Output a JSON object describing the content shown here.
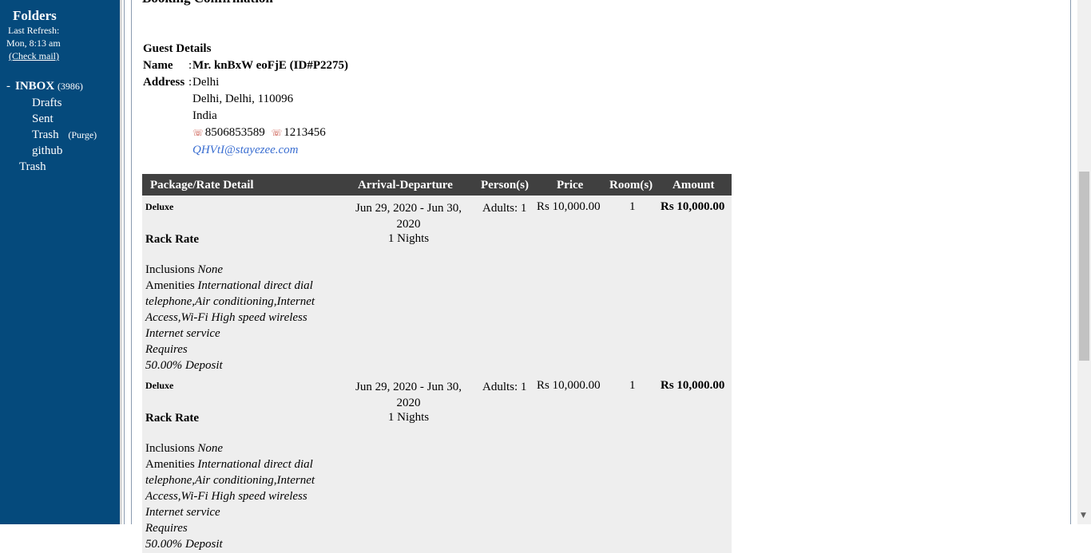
{
  "sidebar": {
    "title": "Folders",
    "last_refresh_label": "Last Refresh:",
    "last_refresh_time": "Mon, 8:13 am",
    "check_mail": "(Check mail)",
    "inbox": {
      "toggle": "-",
      "name": "INBOX",
      "count": "(3986)"
    },
    "folders": [
      "Drafts",
      "Sent",
      "Trash",
      "github"
    ],
    "purge": "(Purge)",
    "trash_root": "Trash"
  },
  "main": {
    "title": "Booking Confirmation",
    "guest_heading": "Guest Details",
    "name_label": "Name",
    "name_colon": ":",
    "name_value": "Mr. knBxW eoFjE (ID#P2275)",
    "address_label": "Address",
    "address_colon": ":",
    "address_line1": "Delhi",
    "address_line2": "Delhi, Delhi, 110096",
    "address_line3": "India",
    "phone1": "8506853589",
    "phone2": "1213456",
    "email": "QHVtI@stayezee.com"
  },
  "table": {
    "headers": [
      "Package/Rate Detail",
      "Arrival-Departure",
      "Person(s)",
      "Price",
      "Room(s)",
      "Amount"
    ],
    "rows": [
      {
        "room": "Deluxe",
        "rate": "Rack Rate",
        "inclusions_label": "Inclusions",
        "inclusions": "None",
        "amenities_label": "Amenities",
        "amenities_1": "International direct dial",
        "amenities_2": "telephone,Air conditioning,Internet",
        "amenities_3": "Access,Wi-Fi High speed wireless",
        "amenities_4": "Internet service",
        "requires": "Requires",
        "deposit": "50.00% Deposit",
        "dates_1": "Jun 29, 2020 - Jun 30,",
        "dates_2": "2020",
        "nights": "1 Nights",
        "persons": "Adults: 1",
        "price": "Rs 10,000.00",
        "rooms": "1",
        "amount": "Rs 10,000.00"
      },
      {
        "room": "Deluxe",
        "rate": "Rack Rate",
        "inclusions_label": "Inclusions",
        "inclusions": "None",
        "amenities_label": "Amenities",
        "amenities_1": "International direct dial",
        "amenities_2": "telephone,Air conditioning,Internet",
        "amenities_3": "Access,Wi-Fi High speed wireless",
        "amenities_4": "Internet service",
        "requires": "Requires",
        "deposit": "50.00% Deposit",
        "dates_1": "Jun 29, 2020 - Jun 30,",
        "dates_2": "2020",
        "nights": "1 Nights",
        "persons": "Adults: 1",
        "price": "Rs 10,000.00",
        "rooms": "1",
        "amount": "Rs 10,000.00"
      }
    ]
  },
  "icons": {
    "phone": "phone-icon",
    "scroll_down": "scroll-down-arrow-icon"
  }
}
